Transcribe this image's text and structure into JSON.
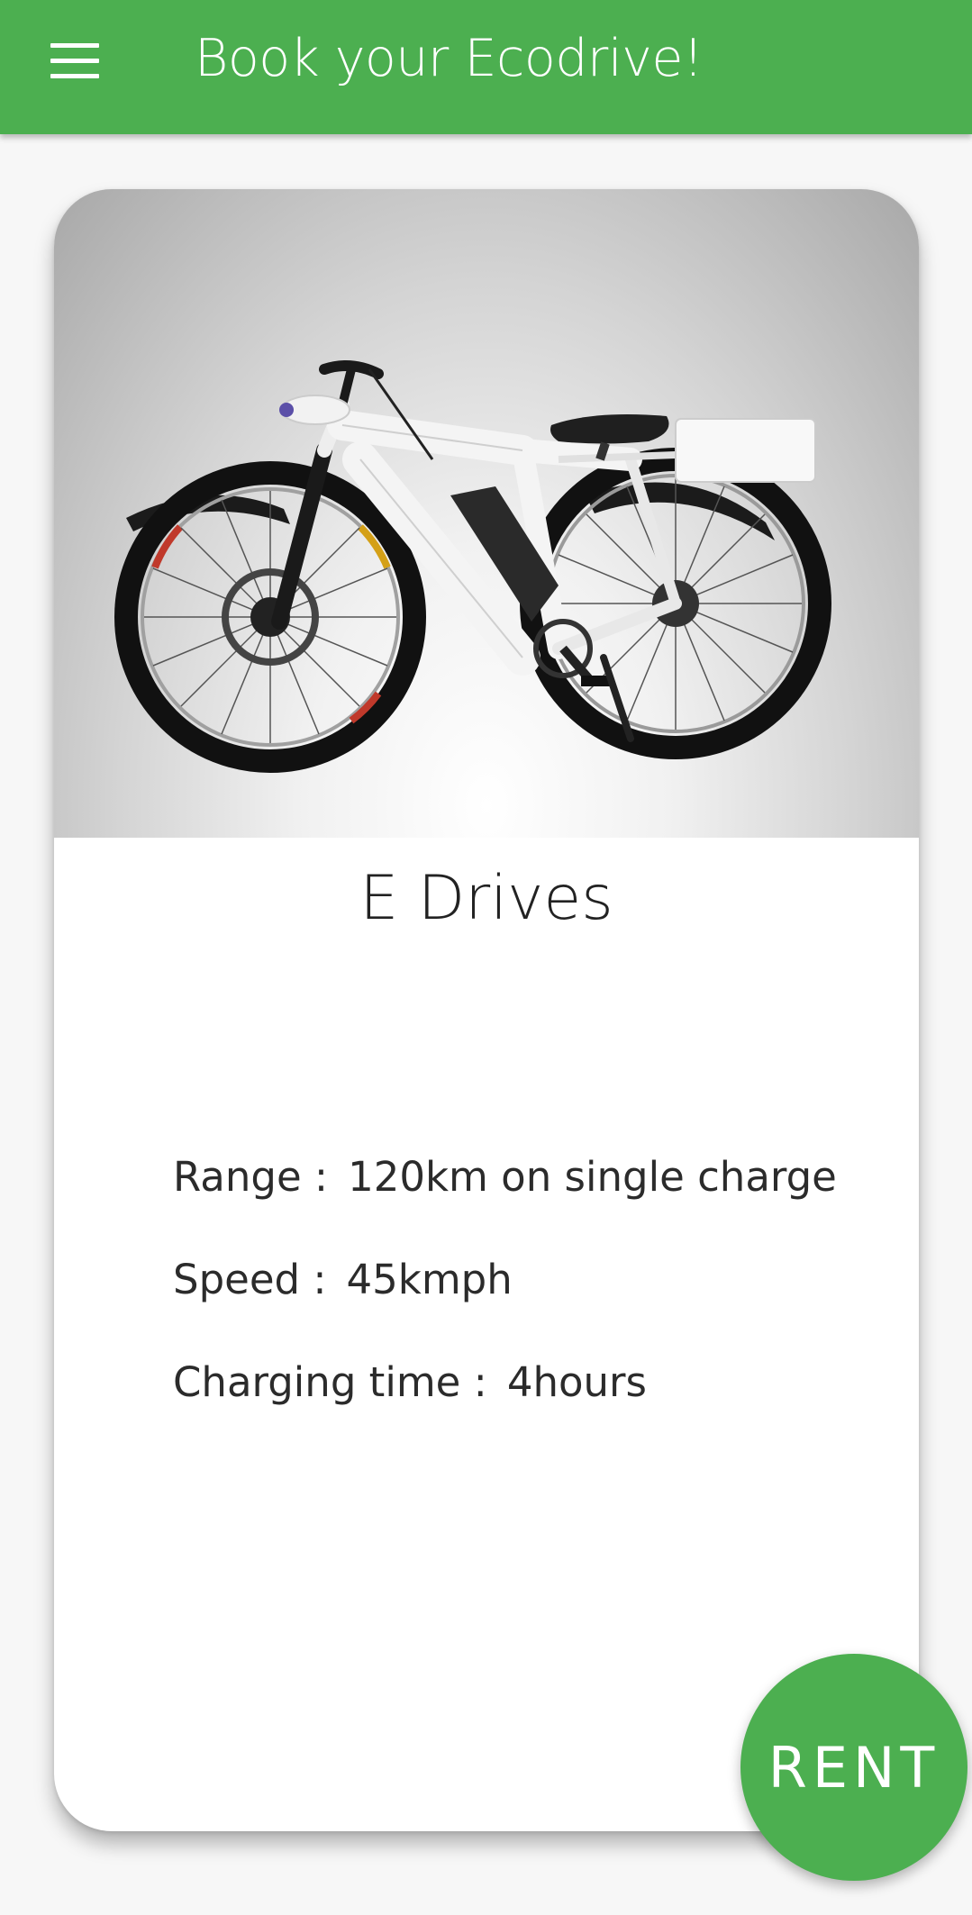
{
  "appbar": {
    "title": "Book your Ecodrive!",
    "menu_icon": "hamburger-menu-icon",
    "color": "#4caf50"
  },
  "card": {
    "image_alt": "electric bicycle",
    "title": "E Drives",
    "specs": [
      {
        "label": "Range :",
        "value": "120km on single charge"
      },
      {
        "label": "Speed :",
        "value": "45kmph"
      },
      {
        "label": "Charging time :",
        "value": "4hours"
      }
    ]
  },
  "actions": {
    "rent_label": "RENT"
  }
}
